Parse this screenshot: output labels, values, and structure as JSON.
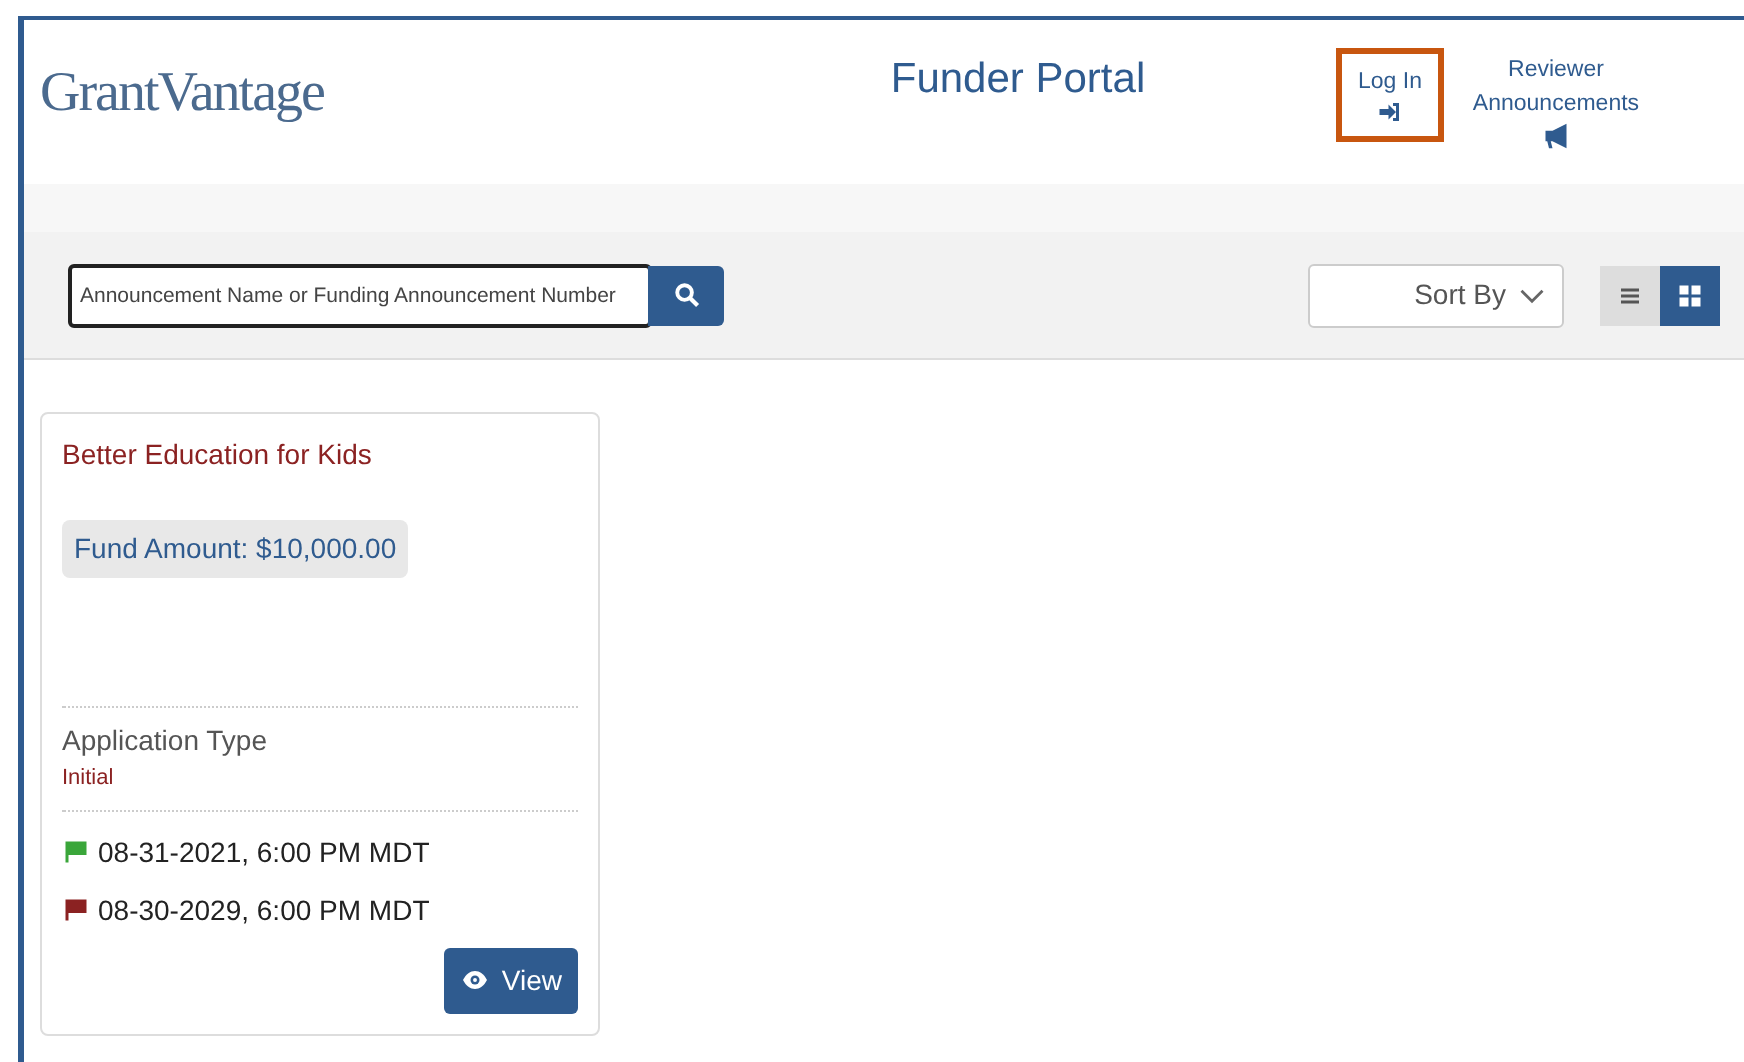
{
  "header": {
    "logo": "GrantVantage",
    "title": "Funder Portal",
    "nav": [
      {
        "label": "Log In",
        "kind": "login",
        "highlighted": true
      },
      {
        "label": "Reviewer Announcements",
        "kind": "megaphone",
        "highlighted": false
      }
    ]
  },
  "toolbar": {
    "search": {
      "placeholder": "Announcement Name or Funding Announcement Number"
    },
    "sort": {
      "label": "Sort By"
    },
    "views": [
      {
        "kind": "list",
        "selected": false
      },
      {
        "kind": "grid",
        "selected": true
      }
    ]
  },
  "cards": [
    {
      "title": "Better Education for Kids",
      "fund_amount": "Fund Amount: $10,000.00",
      "field_label": "Application Type",
      "field_value": "Initial",
      "dates": [
        {
          "text": "08-31-2021, 6:00 PM MDT",
          "color": "#3aa63a"
        },
        {
          "text": "08-30-2029, 6:00 PM MDT",
          "color": "#8b2222"
        }
      ],
      "button": "View"
    }
  ]
}
